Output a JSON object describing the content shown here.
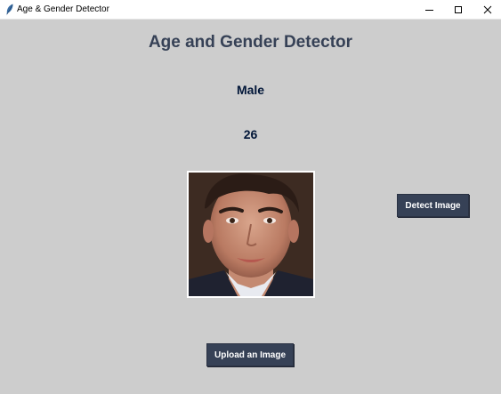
{
  "window": {
    "title": "Age & Gender Detector",
    "icon": "feather-icon",
    "controls": {
      "minimize": "minimize-icon",
      "maximize": "maximize-icon",
      "close": "close-icon"
    }
  },
  "main": {
    "heading": "Age and Gender Detector",
    "gender_result": "Male",
    "age_result": "26",
    "photo": "uploaded-face-photo",
    "detect_button": "Detect Image",
    "upload_button": "Upload an Image"
  },
  "colors": {
    "background": "#cdcdcd",
    "heading": "#364156",
    "result_text": "#011638",
    "button_bg": "#364156",
    "button_text": "#ffffff"
  }
}
